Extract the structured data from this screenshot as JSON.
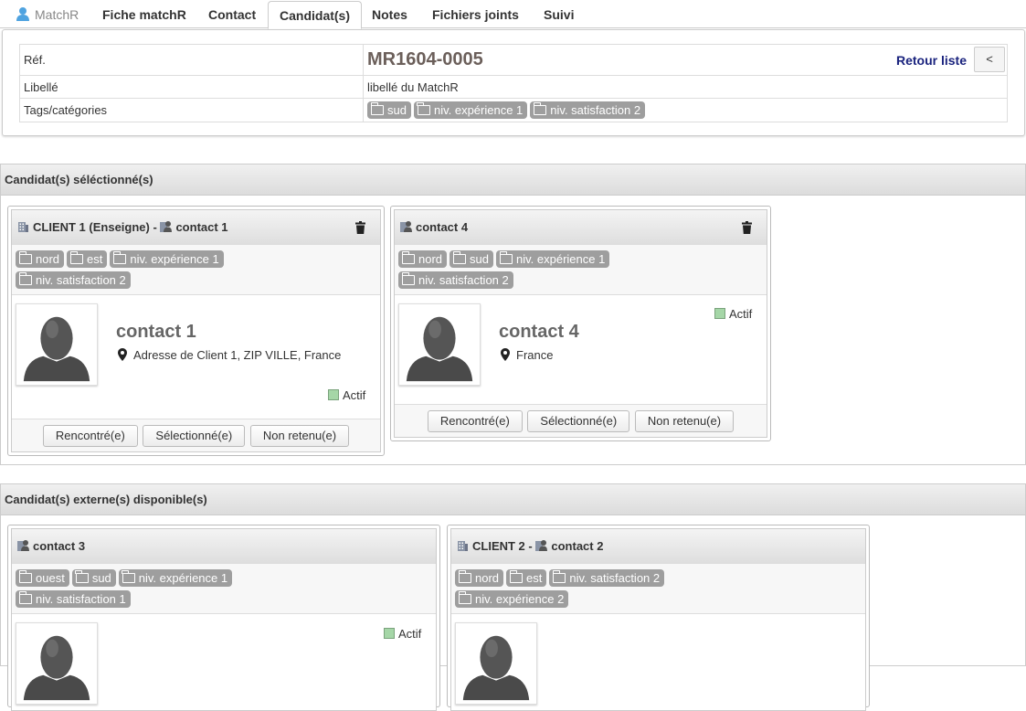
{
  "tabs": [
    {
      "label": "MatchR"
    },
    {
      "label": "Fiche matchR"
    },
    {
      "label": "Contact"
    },
    {
      "label": "Candidat(s)"
    },
    {
      "label": "Notes"
    },
    {
      "label": "Fichiers joints"
    },
    {
      "label": "Suivi"
    }
  ],
  "info": {
    "ref_label": "Réf.",
    "ref_value": "MR1604-0005",
    "back_label": "Retour liste",
    "back_btn": "<",
    "libelle_label": "Libellé",
    "libelle_value": "libellé du MatchR",
    "tags_label": "Tags/catégories",
    "tags": [
      "sud",
      "niv. expérience 1",
      "niv. satisfaction 2"
    ]
  },
  "selected": {
    "title": "Candidat(s) séléctionné(s)",
    "cards": [
      {
        "client": "CLIENT 1 (Enseigne)",
        "sep": "-",
        "contact": "contact 1",
        "tags": [
          "nord",
          "est",
          "niv. expérience 1",
          "niv. satisfaction 2"
        ],
        "name": "contact 1",
        "address": "Adresse de Client 1, ZIP VILLE, France",
        "status": "Actif"
      },
      {
        "client": "",
        "sep": "",
        "contact": "contact 4",
        "tags": [
          "nord",
          "sud",
          "niv. expérience 1",
          "niv. satisfaction 2"
        ],
        "name": "contact 4",
        "address": "France",
        "status": "Actif"
      }
    ],
    "buttons": [
      "Rencontré(e)",
      "Sélectionné(e)",
      "Non retenu(e)"
    ]
  },
  "external": {
    "title": "Candidat(s) externe(s) disponible(s)",
    "cards": [
      {
        "client": "",
        "sep": "",
        "contact": "contact 3",
        "tags": [
          "ouest",
          "sud",
          "niv. expérience 1",
          "niv. satisfaction 1"
        ],
        "status": "Actif"
      },
      {
        "client": "CLIENT 2",
        "sep": "-",
        "contact": "contact 2",
        "tags": [
          "nord",
          "est",
          "niv. satisfaction 2",
          "niv. expérience 2"
        ]
      }
    ]
  },
  "colors": {
    "tag_bg": "#9e9e9e",
    "status_active": "#a5d6a7",
    "ref_text": "#6b5f5a",
    "link": "#1a237e"
  }
}
